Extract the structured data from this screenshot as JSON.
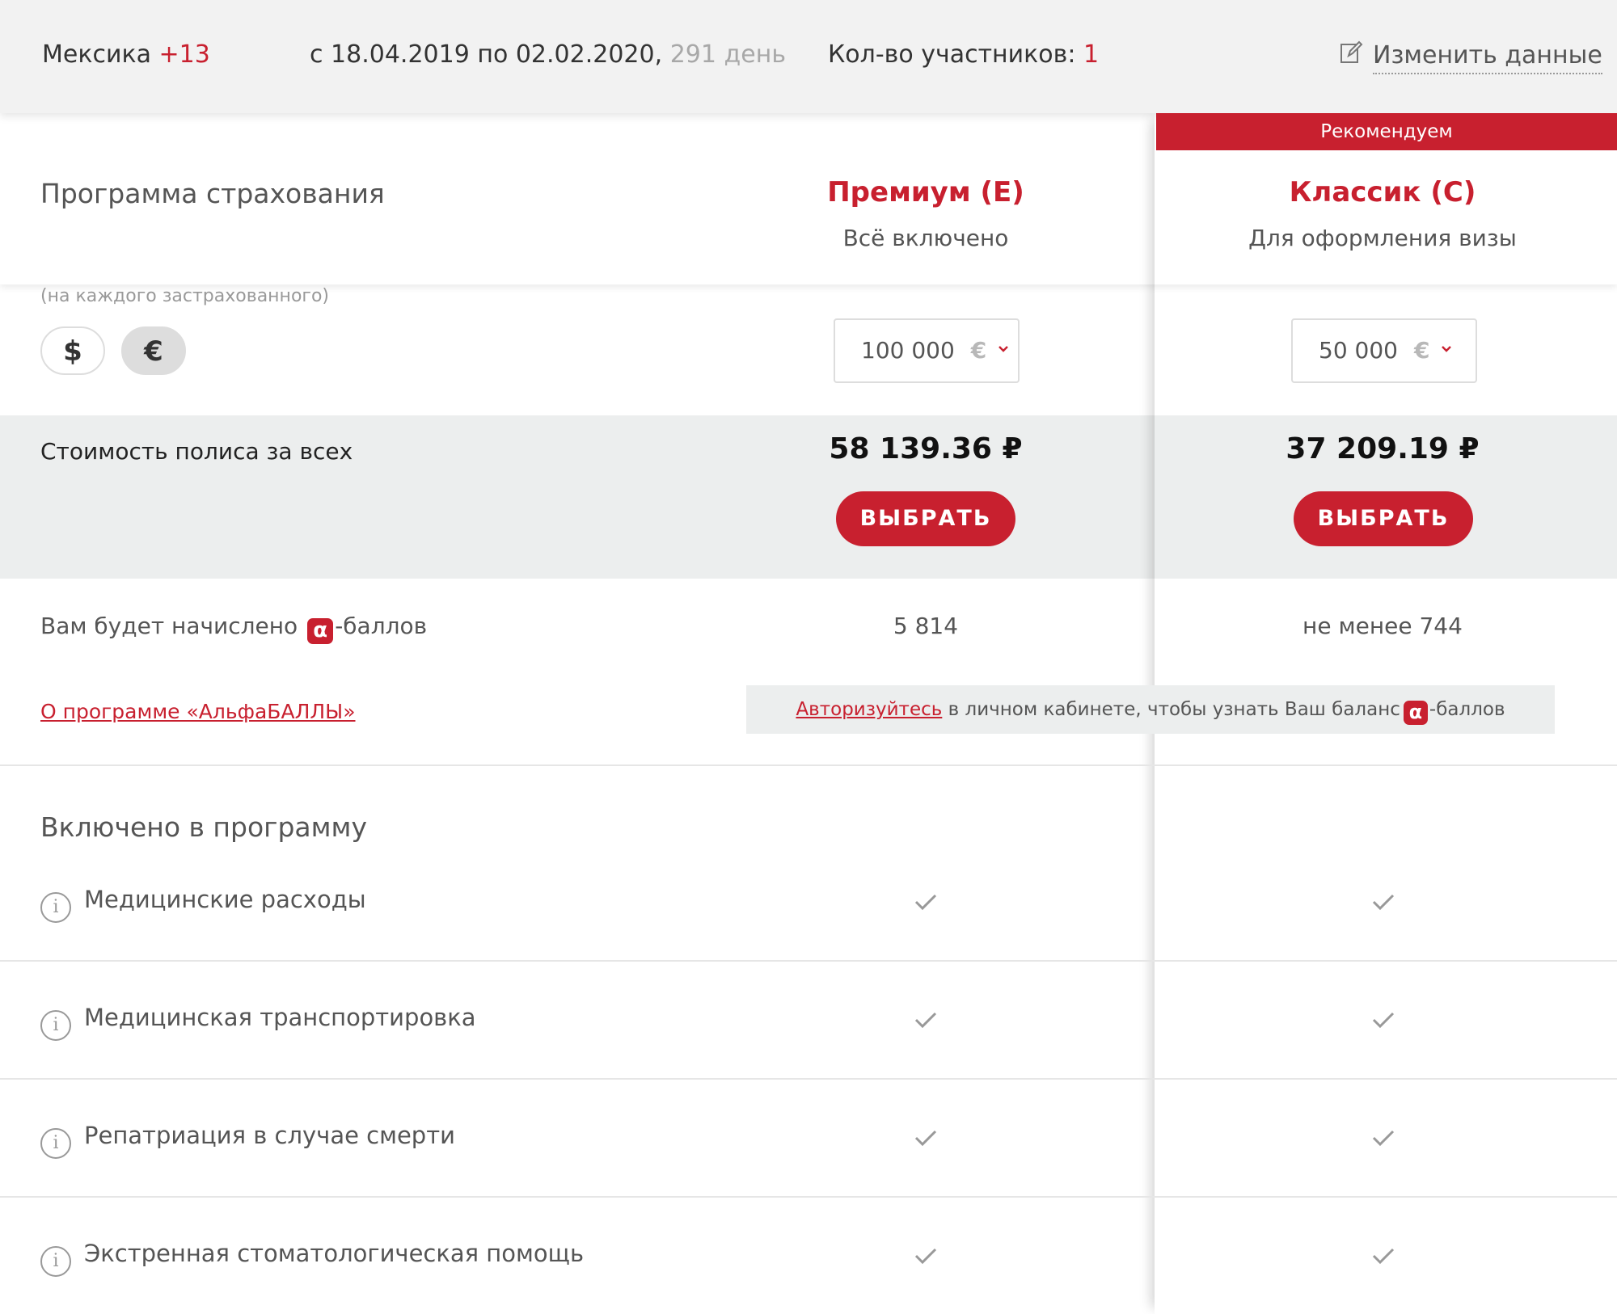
{
  "topbar": {
    "country": "Мексика",
    "country_extra": "+13",
    "dates": "с 18.04.2019 по 02.02.2020,",
    "days": "291 день",
    "participants_label": "Кол-во участников:",
    "participants_count": "1",
    "edit_label": "Изменить данные"
  },
  "program": {
    "title": "Программа страхования",
    "recommended_label": "Рекомендуем",
    "per_person": "(на каждого застрахованного)",
    "currencies": [
      "$",
      "€"
    ],
    "selected_currency": "€"
  },
  "plans": [
    {
      "name": "Премиум (E)",
      "subtitle": "Всё включено",
      "sum_insured": "100 000",
      "currency": "€",
      "price": "58 139.36 ₽",
      "button": "ВЫБРАТЬ",
      "points": "5 814"
    },
    {
      "name": "Классик (C)",
      "subtitle": "Для оформления визы",
      "sum_insured": "50 000",
      "currency": "€",
      "price": "37 209.19 ₽",
      "button": "ВЫБРАТЬ",
      "points": "не менее 744"
    }
  ],
  "price_row": {
    "label": "Стоимость полиса за всех"
  },
  "points_row": {
    "label_before": "Вам будет начислено",
    "alpha_symbol": "α",
    "label_after": "-баллов",
    "about_link": "О программе «АльфаБАЛЛЫ»",
    "auth_link": "Авторизуйтесь",
    "auth_text": " в личном кабинете, чтобы узнать Ваш баланс",
    "auth_suffix": "-баллов"
  },
  "included": {
    "title": "Включено в программу",
    "info_symbol": "i",
    "features": [
      "Медицинские расходы",
      "Медицинская транспортировка",
      "Репатриация в случае смерти",
      "Экстренная стоматологическая помощь"
    ]
  },
  "colors": {
    "accent": "#c8202f",
    "band": "#eceeee",
    "topbar": "#f2f2f2"
  },
  "icons": {
    "edit": "pencil-edit-icon",
    "check": "check-icon",
    "info": "info-icon",
    "chevron": "chevron-down-icon"
  }
}
